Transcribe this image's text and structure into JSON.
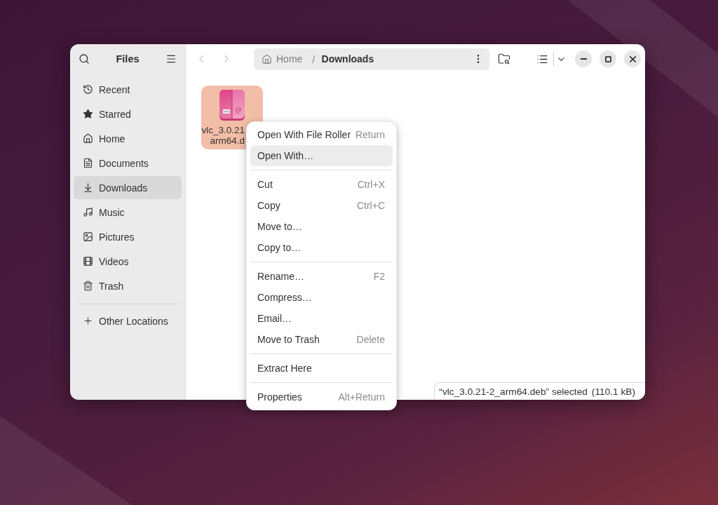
{
  "window": {
    "title": "Files"
  },
  "sidebar": {
    "items": [
      {
        "label": "Recent",
        "selected": false
      },
      {
        "label": "Starred",
        "selected": false
      },
      {
        "label": "Home",
        "selected": false
      },
      {
        "label": "Documents",
        "selected": false
      },
      {
        "label": "Downloads",
        "selected": true
      },
      {
        "label": "Music",
        "selected": false
      },
      {
        "label": "Pictures",
        "selected": false
      },
      {
        "label": "Videos",
        "selected": false
      },
      {
        "label": "Trash",
        "selected": false
      }
    ],
    "other_locations": {
      "label": "Other Locations"
    }
  },
  "toolbar": {
    "back": {
      "disabled": true
    },
    "forward": {
      "disabled": true
    },
    "path": [
      {
        "label": "Home",
        "selected": false
      },
      {
        "label": "Downloads",
        "selected": true
      }
    ],
    "separator": "/"
  },
  "files": [
    {
      "name_lines": [
        "vlc_3.0.21",
        "arm64.d"
      ],
      "selected": true
    }
  ],
  "context_menu": {
    "sections": [
      [
        {
          "label": "Open With File Roller",
          "shortcut": "Return",
          "selected": false
        },
        {
          "label": "Open With…",
          "selected": true
        }
      ],
      [
        {
          "label": "Cut",
          "shortcut": "Ctrl+X",
          "selected": false
        },
        {
          "label": "Copy",
          "shortcut": "Ctrl+C",
          "selected": false
        },
        {
          "label": "Move to…",
          "selected": false
        },
        {
          "label": "Copy to…",
          "selected": false
        }
      ],
      [
        {
          "label": "Rename…",
          "shortcut": "F2",
          "selected": false
        },
        {
          "label": "Compress…",
          "selected": false
        },
        {
          "label": "Email…",
          "selected": false
        },
        {
          "label": "Move to Trash",
          "shortcut": "Delete",
          "selected": false
        }
      ],
      [
        {
          "label": "Extract Here",
          "selected": false
        }
      ],
      [
        {
          "label": "Properties",
          "shortcut": "Alt+Return",
          "selected": false
        }
      ]
    ]
  },
  "status_bar": {
    "selection": "“vlc_3.0.21-2_arm64.deb” selected",
    "size": "(110.1 kB)"
  }
}
